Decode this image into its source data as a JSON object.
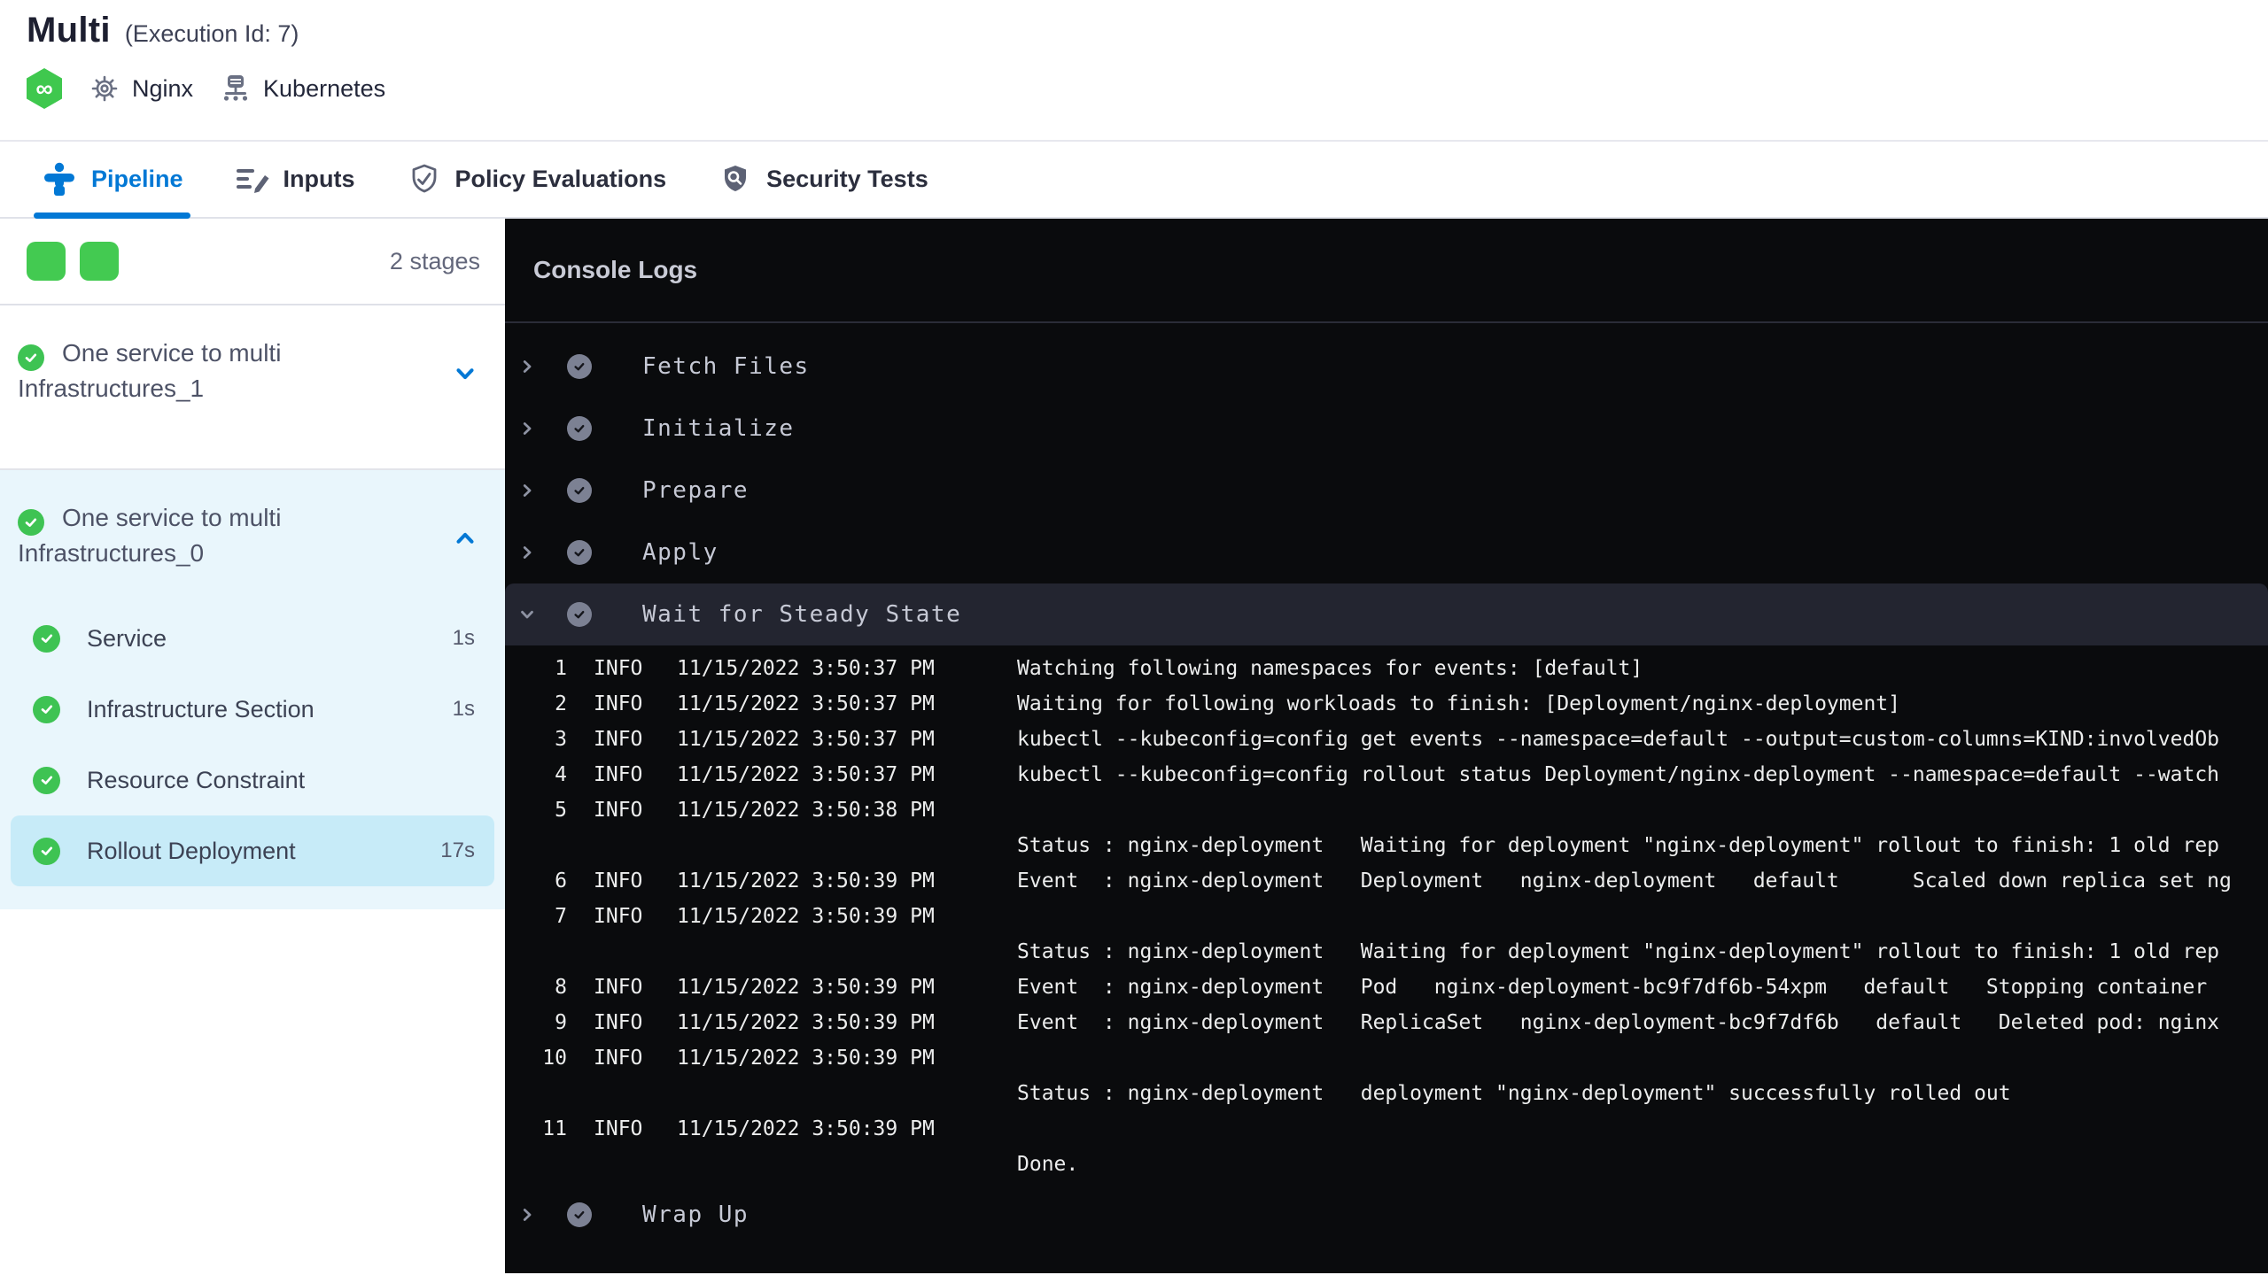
{
  "header": {
    "title": "Multi",
    "execution_id": "(Execution Id: 7)",
    "service_name": "Nginx",
    "infrastructure_name": "Kubernetes"
  },
  "tabs": {
    "pipeline": "Pipeline",
    "inputs": "Inputs",
    "policy": "Policy Evaluations",
    "security": "Security Tests",
    "active": "Pipeline"
  },
  "sidebar": {
    "stage_count": "2 stages",
    "stages": [
      {
        "name": "One service to multi Infrastructures_1",
        "status": "success",
        "expanded": false
      },
      {
        "name": "One service to multi Infrastructures_0",
        "status": "success",
        "expanded": true
      }
    ],
    "steps": [
      {
        "name": "Service",
        "duration": "1s",
        "status": "success",
        "selected": false
      },
      {
        "name": "Infrastructure Section",
        "duration": "1s",
        "status": "success",
        "selected": false
      },
      {
        "name": "Resource Constraint",
        "duration": "",
        "status": "success",
        "selected": false
      },
      {
        "name": "Rollout Deployment",
        "duration": "17s",
        "status": "success",
        "selected": true
      }
    ]
  },
  "console": {
    "title": "Console Logs",
    "sections": [
      "Fetch Files",
      "Initialize",
      "Prepare",
      "Apply"
    ],
    "expanded_section": "Wait for Steady State",
    "closing_section": "Wrap Up",
    "log_rows": [
      {
        "n": "1",
        "level": "INFO",
        "time": "11/15/2022 3:50:37 PM",
        "msg": "Watching following namespaces for events: [default]"
      },
      {
        "n": "2",
        "level": "INFO",
        "time": "11/15/2022 3:50:37 PM",
        "msg": "Waiting for following workloads to finish: [Deployment/nginx-deployment]"
      },
      {
        "n": "3",
        "level": "INFO",
        "time": "11/15/2022 3:50:37 PM",
        "msg": "kubectl --kubeconfig=config get events --namespace=default --output=custom-columns=KIND:involvedOb"
      },
      {
        "n": "4",
        "level": "INFO",
        "time": "11/15/2022 3:50:37 PM",
        "msg": "kubectl --kubeconfig=config rollout status Deployment/nginx-deployment --namespace=default --watch"
      },
      {
        "n": "5",
        "level": "INFO",
        "time": "11/15/2022 3:50:38 PM",
        "msg": ""
      },
      {
        "n": "",
        "level": "",
        "time": "",
        "msg": "Status : nginx-deployment   Waiting for deployment \"nginx-deployment\" rollout to finish: 1 old rep"
      },
      {
        "n": "6",
        "level": "INFO",
        "time": "11/15/2022 3:50:39 PM",
        "msg": "Event  : nginx-deployment   Deployment   nginx-deployment   default      Scaled down replica set ng"
      },
      {
        "n": "7",
        "level": "INFO",
        "time": "11/15/2022 3:50:39 PM",
        "msg": ""
      },
      {
        "n": "",
        "level": "",
        "time": "",
        "msg": "Status : nginx-deployment   Waiting for deployment \"nginx-deployment\" rollout to finish: 1 old rep"
      },
      {
        "n": "8",
        "level": "INFO",
        "time": "11/15/2022 3:50:39 PM",
        "msg": "Event  : nginx-deployment   Pod   nginx-deployment-bc9f7df6b-54xpm   default   Stopping container"
      },
      {
        "n": "9",
        "level": "INFO",
        "time": "11/15/2022 3:50:39 PM",
        "msg": "Event  : nginx-deployment   ReplicaSet   nginx-deployment-bc9f7df6b   default   Deleted pod: nginx"
      },
      {
        "n": "10",
        "level": "INFO",
        "time": "11/15/2022 3:50:39 PM",
        "msg": ""
      },
      {
        "n": "",
        "level": "",
        "time": "",
        "msg": "Status : nginx-deployment   deployment \"nginx-deployment\" successfully rolled out"
      },
      {
        "n": "11",
        "level": "INFO",
        "time": "11/15/2022 3:50:39 PM",
        "msg": ""
      },
      {
        "n": "",
        "level": "",
        "time": "",
        "msg": "Done."
      }
    ]
  },
  "colors": {
    "accent_blue": "#0278d5",
    "success_green": "#3ec353",
    "stage_expanded_bg": "#e9f6fc",
    "step_selected_bg": "#c7ebf8",
    "console_bg": "#0a0b0d",
    "console_section_highlight": "#232530"
  },
  "icons": {
    "pipeline_type": "harness-cd-icon",
    "service": "gear-icon",
    "infrastructure": "kubernetes-icon"
  }
}
